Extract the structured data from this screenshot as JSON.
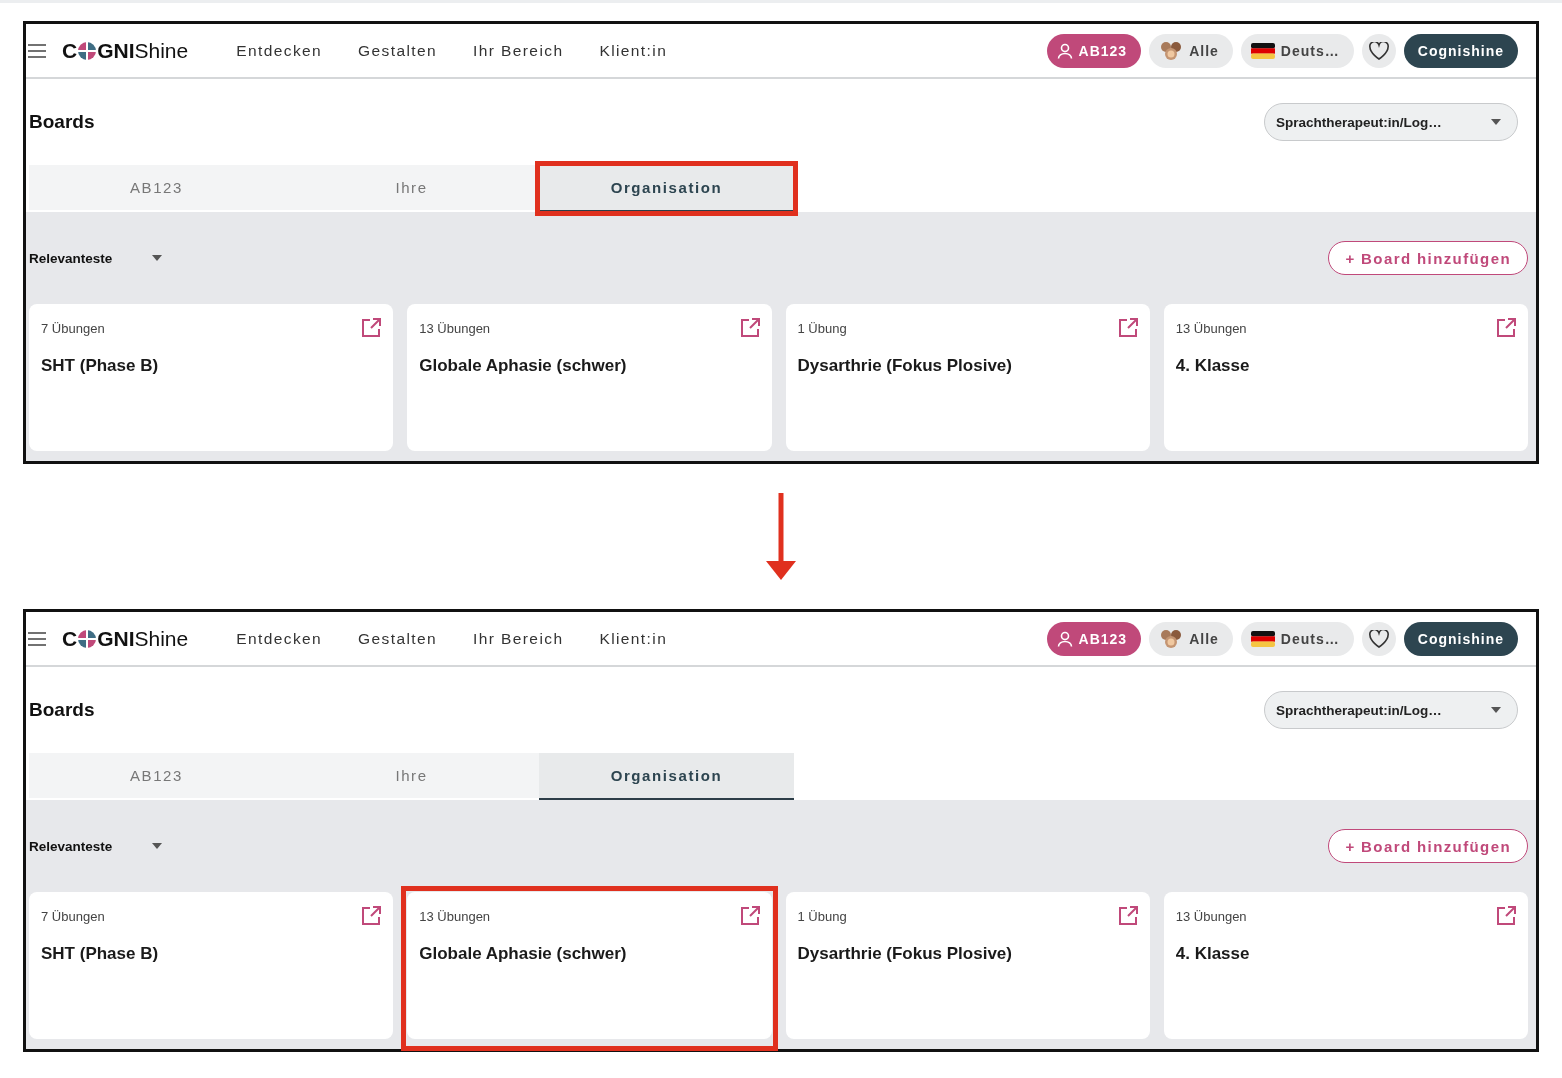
{
  "panels": [
    {
      "logo": {
        "lead": "C",
        "mid": "GNI",
        "tail": "Shine"
      },
      "nav": [
        "Entdecken",
        "Gestalten",
        "Ihr Bereich",
        "Klient:in"
      ],
      "user": "AB123",
      "audience": "Alle",
      "language": "Deuts…",
      "account": "Cognishine",
      "title": "Boards",
      "role": "Sprachtherapeut:in/Log…",
      "tabs": [
        {
          "label": "AB123",
          "selected": false,
          "highlighted": false
        },
        {
          "label": "Ihre",
          "selected": false,
          "highlighted": false
        },
        {
          "label": "Organisation",
          "selected": true,
          "highlighted": true
        }
      ],
      "sort": "Relevanteste",
      "add_button": "+ Board hinzufügen",
      "cards": [
        {
          "count": "7 Übungen",
          "title": "SHT (Phase B)",
          "highlighted": false
        },
        {
          "count": "13 Übungen",
          "title": "Globale Aphasie (schwer)",
          "highlighted": false
        },
        {
          "count": "1 Übung",
          "title": "Dysarthrie (Fokus Plosive)",
          "highlighted": false
        },
        {
          "count": "13 Übungen",
          "title": "4. Klasse",
          "highlighted": false
        }
      ]
    },
    {
      "logo": {
        "lead": "C",
        "mid": "GNI",
        "tail": "Shine"
      },
      "nav": [
        "Entdecken",
        "Gestalten",
        "Ihr Bereich",
        "Klient:in"
      ],
      "user": "AB123",
      "audience": "Alle",
      "language": "Deuts…",
      "account": "Cognishine",
      "title": "Boards",
      "role": "Sprachtherapeut:in/Log…",
      "tabs": [
        {
          "label": "AB123",
          "selected": false,
          "highlighted": false
        },
        {
          "label": "Ihre",
          "selected": false,
          "highlighted": false
        },
        {
          "label": "Organisation",
          "selected": true,
          "highlighted": false
        }
      ],
      "sort": "Relevanteste",
      "add_button": "+ Board hinzufügen",
      "cards": [
        {
          "count": "7 Übungen",
          "title": "SHT (Phase B)",
          "highlighted": false
        },
        {
          "count": "13 Übungen",
          "title": "Globale Aphasie (schwer)",
          "highlighted": true
        },
        {
          "count": "1 Übung",
          "title": "Dysarthrie (Fokus Plosive)",
          "highlighted": false
        },
        {
          "count": "13 Übungen",
          "title": "4. Klasse",
          "highlighted": false
        }
      ]
    }
  ]
}
